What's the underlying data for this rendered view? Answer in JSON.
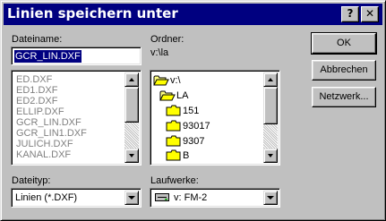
{
  "window": {
    "title": "Linien speichern unter",
    "help_label": "?",
    "close_label": "✕",
    "title_bar_color": "#000080"
  },
  "filename": {
    "label": "Dateiname:",
    "value": "GCR_LIN.DXF",
    "files": [
      "ED.DXF",
      "ED1.DXF",
      "ED2.DXF",
      "ELLIP.DXF",
      "GCR_LIN.DXF",
      "GCR_LIN1.DXF",
      "JULICH.DXF",
      "KANAL.DXF"
    ]
  },
  "folders": {
    "label": "Ordner:",
    "path": "v:\\la",
    "items": [
      {
        "name": "v:\\",
        "icon": "folder-open-icon"
      },
      {
        "name": "LA",
        "icon": "folder-open-icon"
      },
      {
        "name": "151",
        "icon": "folder-icon"
      },
      {
        "name": "93017",
        "icon": "folder-icon"
      },
      {
        "name": "9307",
        "icon": "folder-icon"
      },
      {
        "name": "B",
        "icon": "folder-icon"
      }
    ]
  },
  "filetype": {
    "label": "Dateityp:",
    "value": "Linien (*.DXF)"
  },
  "drives": {
    "label": "Laufwerke:",
    "value": "v: FM-2",
    "icon": "network-drive-icon"
  },
  "buttons": {
    "ok": "OK",
    "cancel": "Abbrechen",
    "network": "Netzwerk..."
  }
}
